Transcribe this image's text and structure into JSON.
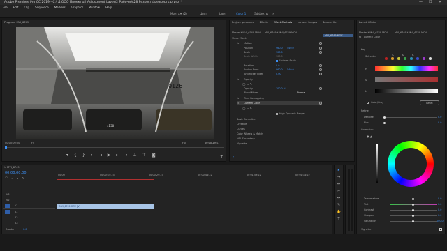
{
  "window": {
    "title": "Adobe Premiere Pro CC 2019 - C:\\ ДЮОО Проекты2 Adjustment Layer\\2 Рабочий\\28 Резкость\\резкость.prproj *",
    "controls": [
      "—",
      "☐",
      "✕"
    ]
  },
  "menu": [
    "File",
    "Edit",
    "Clip",
    "Sequence",
    "Markers",
    "Graphics",
    "Window",
    "Help"
  ],
  "workspaces": [
    "Монтаж (2)",
    "Цвет",
    "Цвет",
    "Color 1",
    "Эффекты"
  ],
  "workspace_active": 3,
  "program": {
    "header": "Program: MVI_6749",
    "timecode_left": "00;00;00;00",
    "fit": "Fit",
    "full": "Full",
    "timecode_right": "00;00;29;11"
  },
  "video": {
    "sign_text": "0126",
    "sticker_text": "4138"
  },
  "effect_controls": {
    "tabs": [
      "Project: резкость",
      "Effects",
      "Effect Controls",
      "Lumetri Scopes",
      "Source: Нет"
    ],
    "source": "Master * MVI_6749.MOV",
    "sequence": "MVI_6749 * MVI_6749.MOV",
    "clip_label": "MVI_6749.MOV",
    "section_video": "Video Effects",
    "motion": "Motion",
    "position": "Position",
    "position_x": "960.0",
    "position_y": "540.0",
    "scale": "Scale",
    "scale_val": "100.0",
    "scale_width": "Scale Width",
    "scale_width_val": "100.0",
    "uniform_scale": "Uniform Scale",
    "rotation": "Rotation",
    "rotation_val": "0.0",
    "anchor": "Anchor Point",
    "anchor_x": "960.0",
    "anchor_y": "540.0",
    "antiflicker": "Anti-flicker Filter",
    "antiflicker_val": "0.00",
    "opacity_section": "Opacity",
    "opacity": "Opacity",
    "opacity_val": "100.0 %",
    "blend": "Blend Mode",
    "blend_val": "Normal",
    "time_remap": "Time Remapping",
    "lumetri": "Lumetri Color",
    "hdr": "High Dynamic Range",
    "items": [
      "Basic Correction",
      "Creative",
      "Curves",
      "Color Wheels & Match",
      "HSL Secondary",
      "Vignette"
    ]
  },
  "lumetri": {
    "header": "Lumetri Color",
    "source": "Master * MVI_6749.MOV",
    "seq": "MVI_6749 * MVI_6749.MOV",
    "fx": "fx",
    "lumetri_label": "Lumetri Color",
    "key": "Key",
    "set_color": "Set color",
    "h": "H",
    "s": "S",
    "l": "L",
    "color_gray": "Color/Gray",
    "reset": "Reset",
    "refine": "Refine",
    "denoise": "Denoise",
    "denoise_val": "0.0",
    "blur": "Blur",
    "blur_val": "0.0",
    "correction": "Correction",
    "temperature": "Temperature",
    "temperature_val": "0.0",
    "tint": "Tint",
    "tint_val": "0.0",
    "contrast": "Contrast",
    "contrast_val": "0.0",
    "sharpen": "Sharpen",
    "sharpen_val": "0.0",
    "saturation": "Saturation",
    "saturation_val": "100.0",
    "vignette": "Vignette"
  },
  "timeline": {
    "header": "MVI_6749",
    "timecode": "00;00;00;00",
    "ruler": [
      "00;00",
      "00;00;14;23",
      "00;00;29;23",
      "00;00;44;22",
      "00;01;59;22",
      "00;01;14;22"
    ],
    "tracks": [
      "V3",
      "V2",
      "V1",
      "A1",
      "A2",
      "A3"
    ],
    "master": "Master",
    "master_val": "0.0",
    "clip_name": "MVI_6749.MOV [V]"
  },
  "colors": {
    "accent": "#3d8ff2",
    "clip": "#a7c4e6",
    "playhead": "#3d8ff2"
  }
}
